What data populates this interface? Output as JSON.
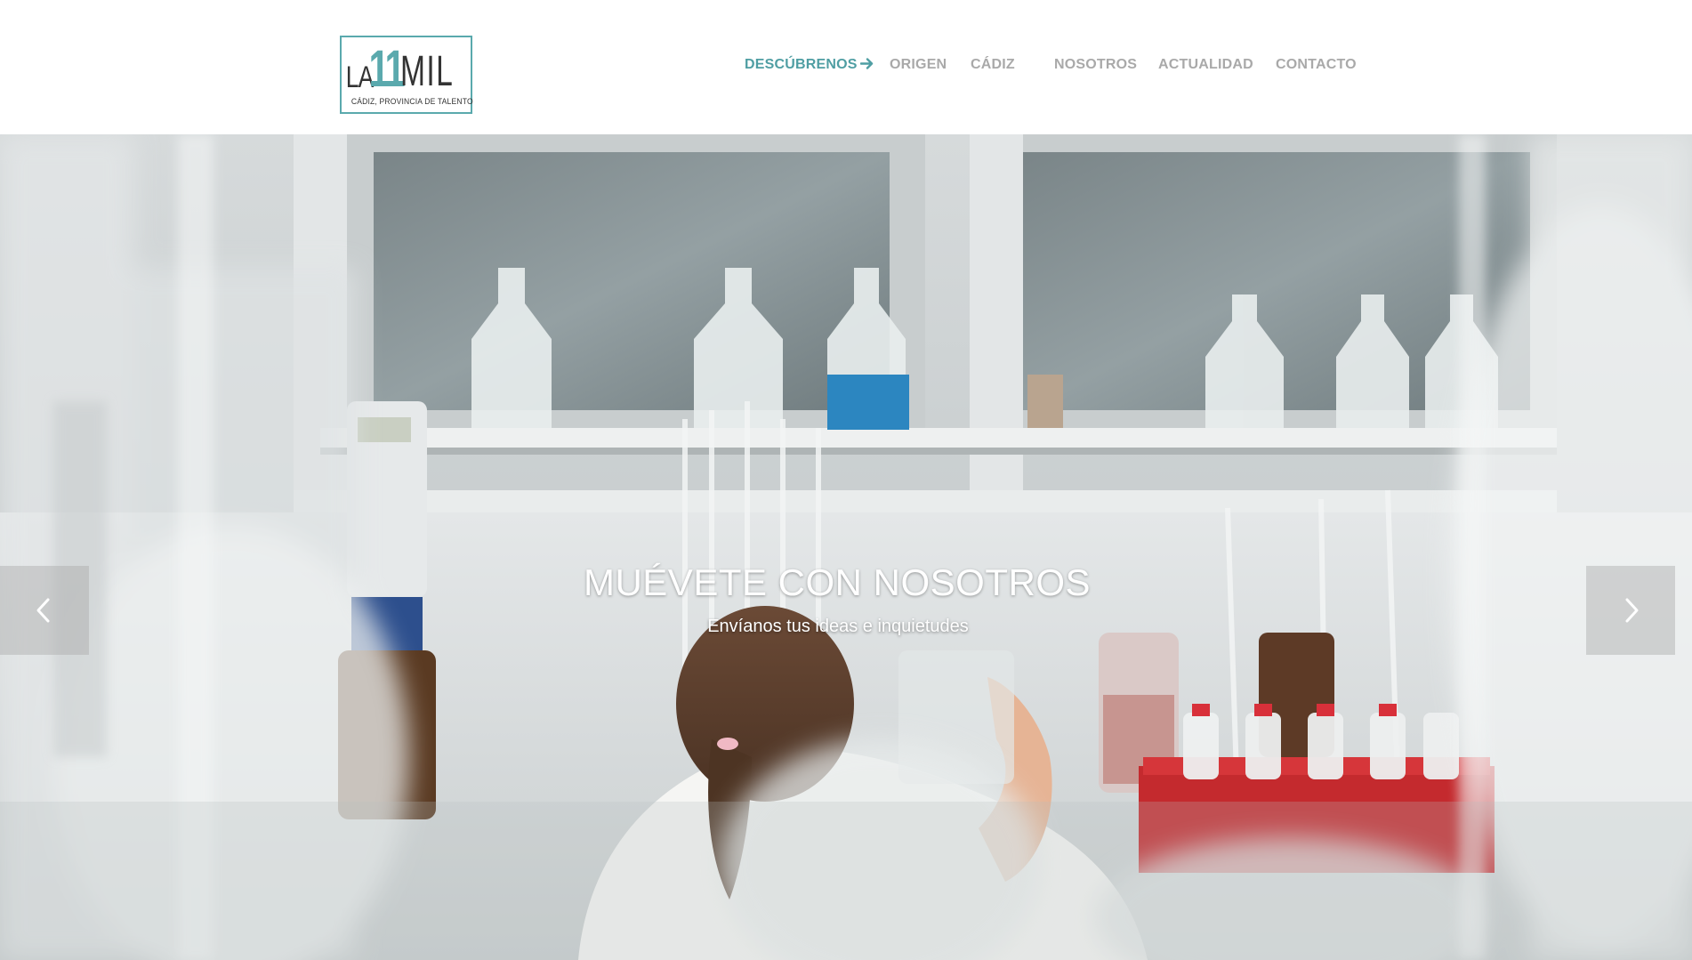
{
  "logo": {
    "prefix": "LA",
    "number": "11",
    "suffix": "MIL",
    "tagline": "CÁDIZ, PROVINCIA DE TALENTO",
    "accent_color": "#5aa9ad"
  },
  "nav": {
    "items": [
      {
        "label": "DESCÚBRENOS",
        "active": true,
        "icon": "arrow-right-icon"
      },
      {
        "label": "ORIGEN",
        "active": false
      },
      {
        "label": "CÁDIZ",
        "active": false
      },
      {
        "label": "NOSOTROS",
        "active": false
      },
      {
        "label": "ACTUALIDAD",
        "active": false
      },
      {
        "label": "CONTACTO",
        "active": false
      }
    ],
    "active_color": "#4f9ea3",
    "inactive_color": "#a9a9a9"
  },
  "hero": {
    "title": "MUÉVETE CON NOSOTROS",
    "subtitle": "Envíanos tus ideas e inquietudes",
    "prev_icon": "chevron-left-icon",
    "next_icon": "chevron-right-icon"
  }
}
